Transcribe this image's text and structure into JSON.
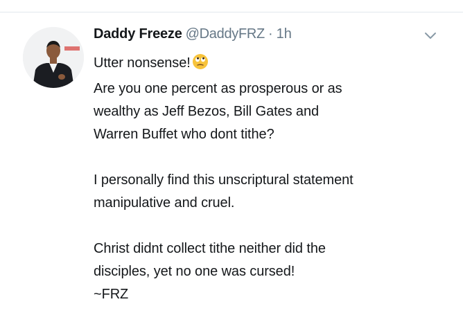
{
  "tweet": {
    "display_name": "Daddy Freeze",
    "handle": "@DaddyFRZ",
    "separator": "·",
    "time": "1h",
    "lines": {
      "l1": "Utter nonsense!",
      "l2": "Are you one percent as prosperous or as",
      "l3": "wealthy as Jeff Bezos, Bill Gates and",
      "l4": "Warren Buffet who dont tithe?",
      "l5": "I personally find this unscriptural statement",
      "l6": "manipulative and cruel.",
      "l7": "Christ didnt collect tithe neither did the",
      "l8": "disciples, yet no one was cursed!",
      "l9": "~FRZ"
    },
    "emoji": "face-with-rolling-eyes-icon"
  },
  "icons": {
    "menu": "chevron-down-icon",
    "avatar": "avatar"
  },
  "colors": {
    "text": "#14171a",
    "secondary": "#657786",
    "divider": "#e1e8ed",
    "emoji": "#f7c33b"
  }
}
